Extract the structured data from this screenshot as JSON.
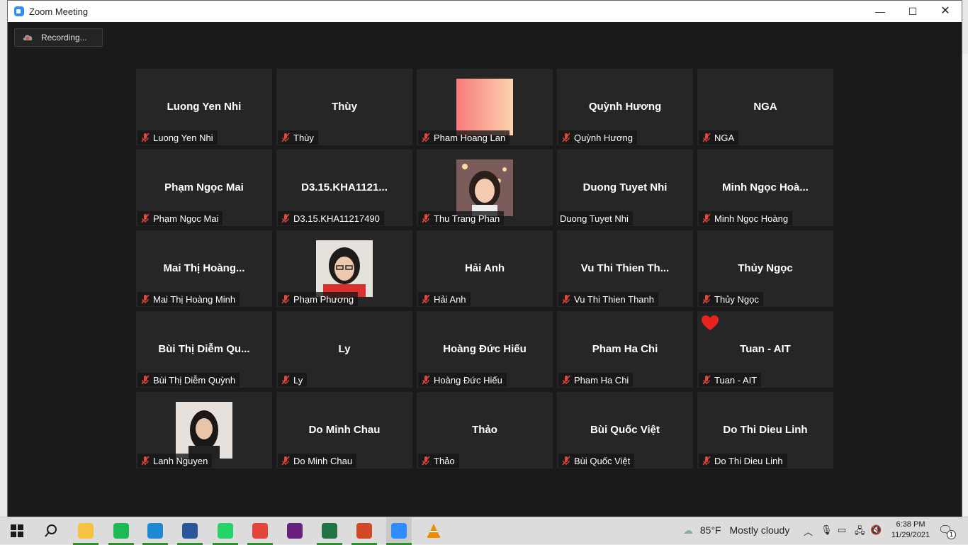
{
  "window": {
    "title": "Zoom Meeting",
    "minimize_glyph": "—",
    "maximize_glyph": "☐",
    "close_glyph": "✕",
    "icon": "zoom-logo-icon",
    "recording_label": "Recording..."
  },
  "colors": {
    "zoom_blue": "#2d8cff",
    "tile_bg": "#262626",
    "meeting_bg": "#1a1a1a",
    "muted_red": "#e0463a"
  },
  "participants": [
    {
      "display": "Luong Yen Nhi",
      "name": "Luong Yen Nhi",
      "muted": true
    },
    {
      "display": "Thùy",
      "name": "Thùy",
      "muted": true
    },
    {
      "display": "",
      "name": "Pham Hoang Lan",
      "muted": true,
      "image": "gradient-placeholder"
    },
    {
      "display": "Quỳnh Hương",
      "name": "Quỳnh Hương",
      "muted": true
    },
    {
      "display": "NGA",
      "name": "NGA",
      "muted": true
    },
    {
      "display": "Phạm Ngọc Mai",
      "name": "Phạm Ngọc Mai",
      "muted": true
    },
    {
      "display": "D3.15.KHA1121...",
      "name": "D3.15.KHA11217490",
      "muted": true
    },
    {
      "display": "",
      "name": "Thu Trang Phan",
      "muted": true,
      "image": "photo-woman-lights"
    },
    {
      "display": "Duong Tuyet Nhi",
      "name": "Duong Tuyet Nhi",
      "muted": false
    },
    {
      "display": "Minh  Ngọc  Hoà...",
      "name": "Minh Ngọc Hoàng",
      "muted": true
    },
    {
      "display": "Mai  Thị  Hoàng...",
      "name": "Mai Thị Hoàng Minh",
      "muted": true
    },
    {
      "display": "",
      "name": "Phạm Phương",
      "muted": true,
      "image": "photo-woman-glasses"
    },
    {
      "display": "Hải Anh",
      "name": "Hải Anh",
      "muted": true
    },
    {
      "display": "Vu Thi Thien Th...",
      "name": "Vu Thi Thien Thanh",
      "muted": true
    },
    {
      "display": "Thủy Ngọc",
      "name": "Thủy Ngọc",
      "muted": true
    },
    {
      "display": "Bùi Thị Diễm Qu...",
      "name": "Bùi Thị Diễm Quỳnh",
      "muted": true
    },
    {
      "display": "Ly",
      "name": "Ly",
      "muted": true
    },
    {
      "display": "Hoàng Đức Hiếu",
      "name": "Hoàng Đức Hiếu",
      "muted": true
    },
    {
      "display": "Pham Ha Chi",
      "name": "Pham Ha Chi",
      "muted": true
    },
    {
      "display": "Tuan - AIT",
      "name": "Tuan - AIT",
      "muted": true,
      "reaction": "heart-icon"
    },
    {
      "display": "",
      "name": "Lanh Nguyen",
      "muted": true,
      "image": "photo-woman-dark-hair"
    },
    {
      "display": "Do Minh Chau",
      "name": "Do Minh Chau",
      "muted": true
    },
    {
      "display": "Thảo",
      "name": "Thảo",
      "muted": true
    },
    {
      "display": "Bùi Quốc Việt",
      "name": "Bùi Quốc Việt",
      "muted": true
    },
    {
      "display": "Do Thi Dieu Linh",
      "name": "Do Thi Dieu Linh",
      "muted": true
    }
  ],
  "taskbar": {
    "apps": [
      {
        "icon": "windows-start-icon",
        "color": "#1a1a1a",
        "running": false
      },
      {
        "icon": "search-icon",
        "color": "#1a1a1a",
        "running": false
      },
      {
        "icon": "file-explorer-icon",
        "color": "#f5c342",
        "running": true
      },
      {
        "icon": "spotify-icon",
        "color": "#1db954",
        "running": true
      },
      {
        "icon": "edge-icon",
        "color": "#1f8ad2",
        "running": true
      },
      {
        "icon": "word-icon",
        "color": "#2b579a",
        "running": true
      },
      {
        "icon": "whatsapp-icon",
        "color": "#25d366",
        "running": true
      },
      {
        "icon": "chrome-icon",
        "color": "#e3453a",
        "running": true
      },
      {
        "icon": "visual-studio-icon",
        "color": "#68217a",
        "running": false
      },
      {
        "icon": "excel-icon",
        "color": "#217346",
        "running": true
      },
      {
        "icon": "powerpoint-icon",
        "color": "#d24726",
        "running": true
      },
      {
        "icon": "zoom-icon",
        "color": "#2d8cff",
        "running": true
      },
      {
        "icon": "vlc-icon",
        "color": "#f08a00",
        "running": false
      }
    ],
    "weather_temp": "85°F",
    "weather_text": "Mostly cloudy",
    "time": "6:38 PM",
    "date": "11/29/2021",
    "notification_count": "1"
  }
}
